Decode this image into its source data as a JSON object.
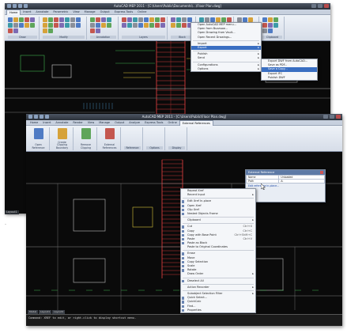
{
  "back_window": {
    "title": "AutoCAD MEP 2011 - [C:\\Users\\Public\\Documents\\...\\Floor Plan.dwg]",
    "tabs": [
      "Home",
      "Insert",
      "Annotate",
      "Parametric",
      "View",
      "Manage",
      "Output",
      "Express Tools",
      "Online"
    ],
    "active_tab": "Home",
    "panels": [
      "Draw",
      "Modify",
      "Annotation",
      "Layers",
      "Block",
      "Properties",
      "Utilities",
      "Clipboard"
    ],
    "ribbon_labels": {
      "layer_state": "Unsaved Layer State",
      "text_label": "Text"
    }
  },
  "file_menu": {
    "items": [
      {
        "label": "Open AutoCAD MEP menu...",
        "shortcut": ""
      },
      {
        "label": "Open from Buzzsaw...",
        "shortcut": ""
      },
      {
        "label": "Open Drawing from Vault...",
        "shortcut": ""
      },
      {
        "label": "Open Recent Drawings...",
        "shortcut": ""
      },
      {
        "sep": true
      },
      {
        "label": "Import",
        "shortcut": "",
        "arrow": true
      },
      {
        "label": "Export",
        "shortcut": "",
        "arrow": true,
        "highlight": true
      },
      {
        "sep": true
      },
      {
        "label": "Publish",
        "shortcut": "",
        "arrow": true
      },
      {
        "label": "Send",
        "shortcut": "",
        "arrow": true
      },
      {
        "sep": true
      },
      {
        "label": "Configurations",
        "shortcut": "",
        "arrow": true
      },
      {
        "label": "Options",
        "shortcut": "",
        "arrow": true
      }
    ]
  },
  "file_submenu": {
    "items": [
      {
        "label": "Export DWF from AutoCAD...",
        "highlight": false
      },
      {
        "label": "Save as PDF...",
        "highlight": false
      },
      {
        "label": "Save a Copy...",
        "highlight": true
      },
      {
        "label": "Export IFC",
        "highlight": false
      },
      {
        "label": "Publish DWF",
        "highlight": false
      }
    ]
  },
  "front_window": {
    "title": "AutoCAD MEP 2011 - [C:\\Users\\Public\\Floor Plan.dwg]",
    "tabs": [
      "Home",
      "Insert",
      "Annotate",
      "Render",
      "View",
      "Manage",
      "Output",
      "Analyze",
      "Express Tools",
      "Online"
    ],
    "active_tab": "External References",
    "panels": [
      "Reference",
      "Options",
      "Display"
    ],
    "ribbon_buttons": [
      "Open Reference",
      "Create Clipping Boundary",
      "Remove Clipping",
      "External References"
    ],
    "layout_tabs": [
      "Model",
      "Layout1",
      "Layout2"
    ],
    "command_line": "Command:  XREF to edit, or right-click to display shortcut menu."
  },
  "properties_palette": {
    "title": "External Reference",
    "rows": [
      {
        "key": "Name",
        "value": "Unloaded"
      },
      {
        "key": "Path",
        "value": "A:"
      }
    ],
    "link": "Edit reference in-place..."
  },
  "context_menu": {
    "items": [
      {
        "label": "Repeat Xref",
        "shortcut": "",
        "icon": false
      },
      {
        "label": "Recent Input",
        "shortcut": "",
        "arrow": true,
        "icon": false
      },
      {
        "sep": true
      },
      {
        "label": "Edit Xref In-place",
        "shortcut": "",
        "icon": true
      },
      {
        "label": "Open Xref",
        "shortcut": "",
        "icon": true
      },
      {
        "label": "Clip Xref",
        "shortcut": "",
        "icon": true
      },
      {
        "label": "Nested Objects Frame",
        "shortcut": "",
        "icon": true
      },
      {
        "sep": true
      },
      {
        "label": "Clipboard",
        "shortcut": "",
        "arrow": true,
        "icon": false
      },
      {
        "sep": true
      },
      {
        "label": "Cut",
        "shortcut": "Ctrl+X",
        "icon": true
      },
      {
        "label": "Copy",
        "shortcut": "Ctrl+C",
        "icon": true
      },
      {
        "label": "Copy with Base Point",
        "shortcut": "Ctrl+Shift+C",
        "icon": true
      },
      {
        "label": "Paste",
        "shortcut": "Ctrl+V",
        "icon": true
      },
      {
        "label": "Paste as Block",
        "shortcut": "",
        "icon": true
      },
      {
        "label": "Paste to Original Coordinates",
        "shortcut": "",
        "icon": false
      },
      {
        "sep": true
      },
      {
        "label": "Erase",
        "shortcut": "",
        "icon": true
      },
      {
        "label": "Move",
        "shortcut": "",
        "icon": true
      },
      {
        "label": "Copy Selection",
        "shortcut": "",
        "icon": true
      },
      {
        "label": "Scale",
        "shortcut": "",
        "icon": true
      },
      {
        "label": "Rotate",
        "shortcut": "",
        "icon": true
      },
      {
        "label": "Draw Order",
        "shortcut": "",
        "arrow": true,
        "icon": false
      },
      {
        "sep": true
      },
      {
        "label": "Deselect All",
        "shortcut": "",
        "icon": true
      },
      {
        "sep": true
      },
      {
        "label": "Action Recorder",
        "shortcut": "",
        "arrow": true,
        "icon": false
      },
      {
        "sep": true
      },
      {
        "label": "Subobject Selection Filter",
        "shortcut": "",
        "arrow": true,
        "icon": false
      },
      {
        "label": "Quick Select...",
        "shortcut": "",
        "icon": true
      },
      {
        "label": "QuickCalc",
        "shortcut": "",
        "icon": true
      },
      {
        "label": "Find...",
        "shortcut": "",
        "icon": true
      },
      {
        "label": "Properties",
        "shortcut": "",
        "icon": true
      }
    ]
  },
  "misc": {
    "layout_label": "Layout1",
    "side_label": "–"
  }
}
